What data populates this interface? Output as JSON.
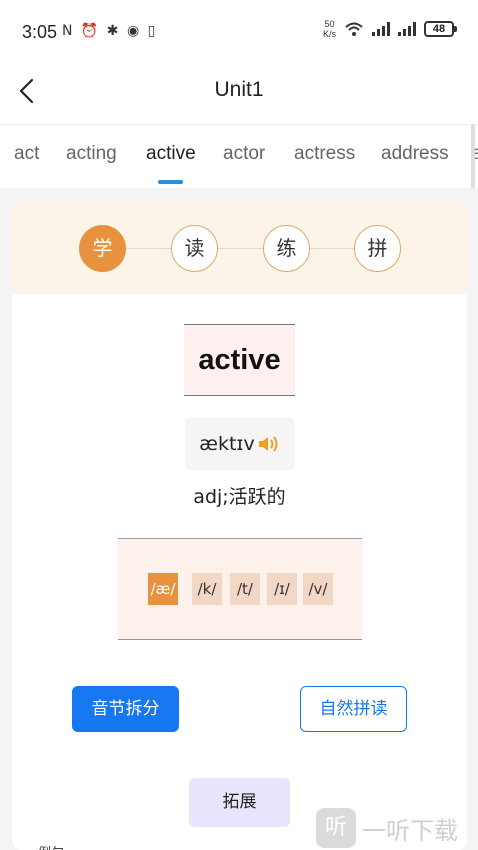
{
  "status_bar": {
    "time": "3:05",
    "indicators": "N ⏰ ✱ ◉ ▯",
    "net_speed_value": "50",
    "net_speed_unit": "K/s",
    "battery": "48"
  },
  "header": {
    "title": "Unit1"
  },
  "tabs": [
    {
      "label": "act"
    },
    {
      "label": "acting"
    },
    {
      "label": "active"
    },
    {
      "label": "actor"
    },
    {
      "label": "actress"
    },
    {
      "label": "address"
    },
    {
      "label": "a"
    }
  ],
  "active_tab": "active",
  "steps": [
    {
      "label": "学"
    },
    {
      "label": "读"
    },
    {
      "label": "练"
    },
    {
      "label": "拼"
    }
  ],
  "word": "active",
  "phonetic": "æktɪv",
  "meaning": "adj;活跃的",
  "phonemes": [
    {
      "label": "/æ/"
    },
    {
      "label": "/k/"
    },
    {
      "label": "/t/"
    },
    {
      "label": "/ɪ/"
    },
    {
      "label": "/v/"
    }
  ],
  "buttons": {
    "syllable_split": "音节拆分",
    "natural_phonics": "自然拼读",
    "expand": "拓展"
  },
  "bottom_peek_text": "例句",
  "watermark": {
    "logo_char": "听",
    "text": "一听下载"
  },
  "colors": {
    "accent_orange": "#e8923f",
    "primary_blue": "#1677f0",
    "tab_indicator": "#2b8fd8",
    "expand_purple": "#e8e4fb"
  }
}
